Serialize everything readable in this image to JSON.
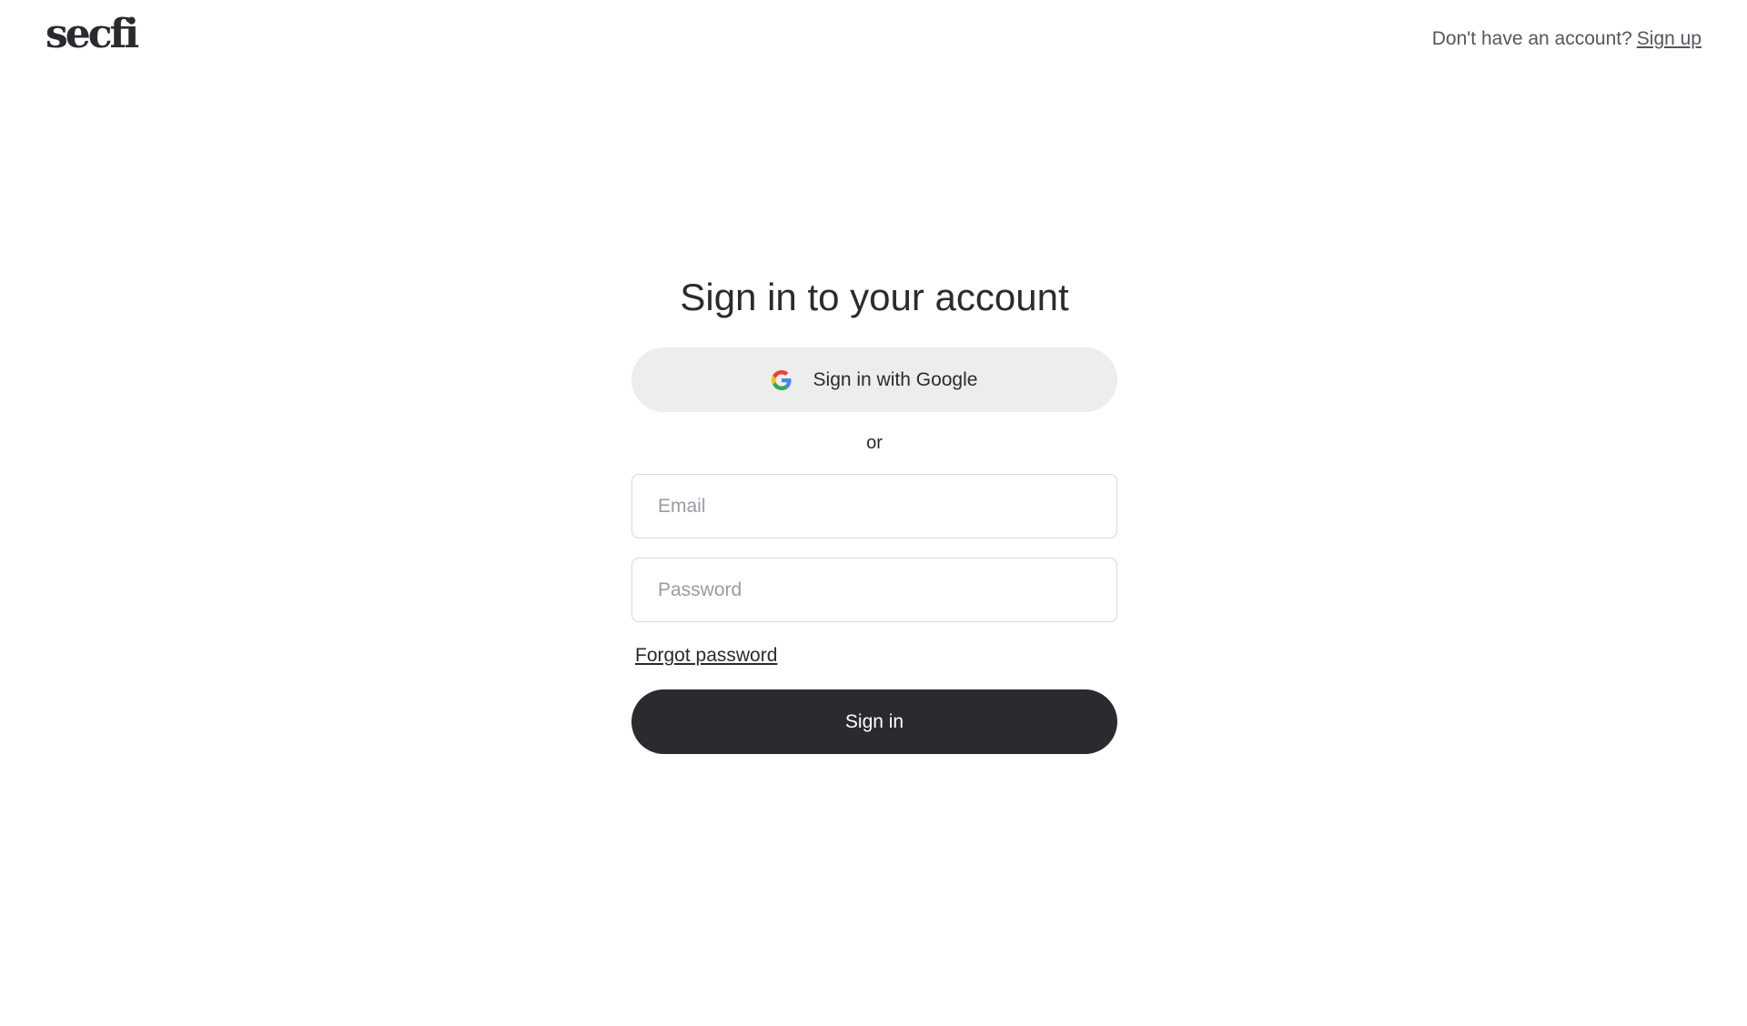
{
  "header": {
    "logo_text": "secfi",
    "signup_prompt": "Don't have an account?",
    "signup_link": "Sign up"
  },
  "form": {
    "title": "Sign in to your account",
    "google_button_label": "Sign in with Google",
    "google_icon": "google-icon",
    "divider_text": "or",
    "email_placeholder": "Email",
    "email_value": "",
    "password_placeholder": "Password",
    "password_value": "",
    "forgot_password_label": "Forgot password",
    "submit_label": "Sign in"
  },
  "colors": {
    "primary_dark": "#2a2b2e",
    "google_button_bg": "#eceded",
    "input_border": "#d6d7d9",
    "muted_text": "#55575c",
    "placeholder_text": "#9a9ca1",
    "google_blue": "#4285F4",
    "google_red": "#EA4335",
    "google_yellow": "#FBBC05",
    "google_green": "#34A853"
  }
}
